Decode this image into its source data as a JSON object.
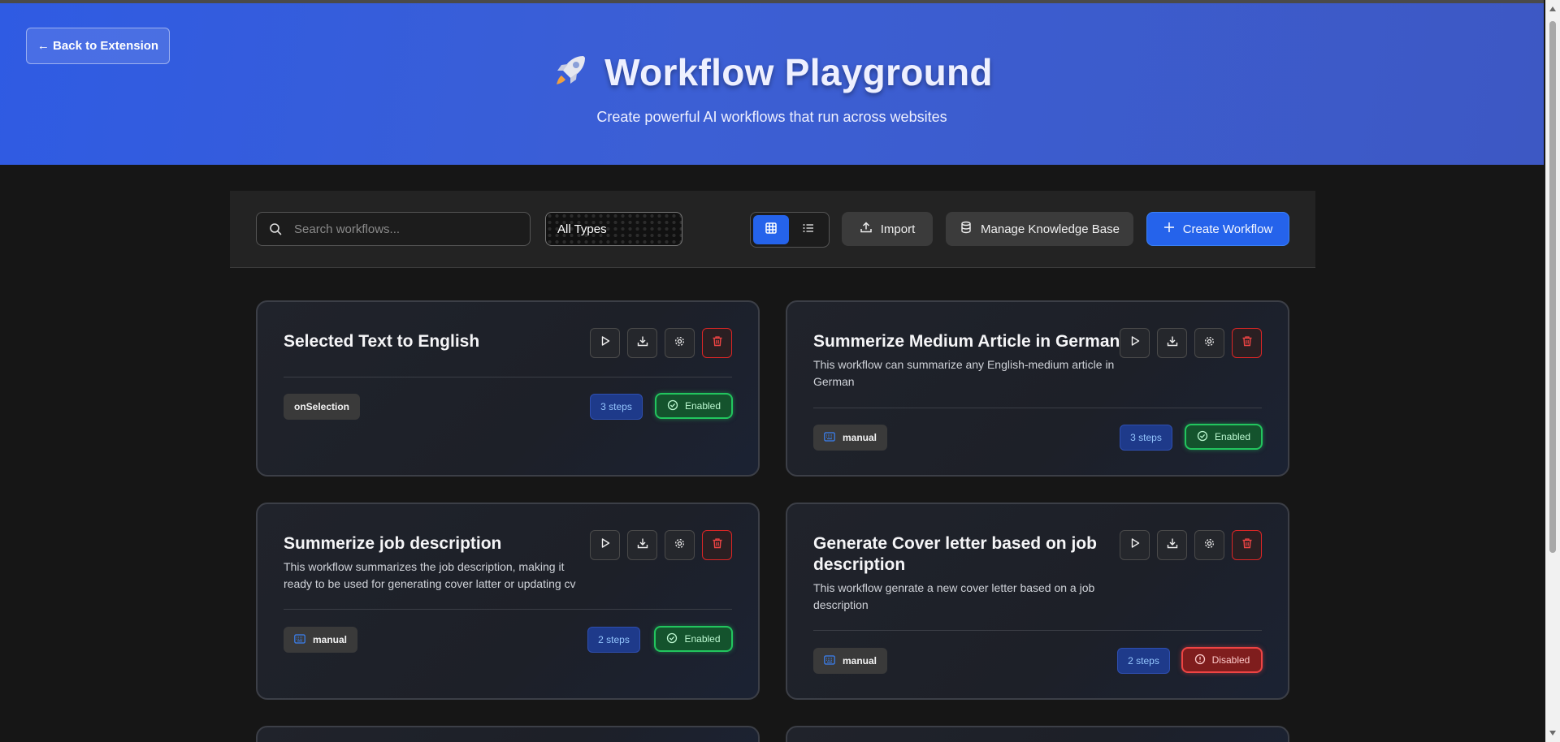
{
  "header": {
    "back_label": "← Back to Extension",
    "title": "Workflow Playground",
    "subtitle": "Create powerful AI workflows that run across websites",
    "gradient_colors": [
      "#2f5be3",
      "#3d58c4"
    ]
  },
  "toolbar": {
    "search_placeholder": "Search workflows...",
    "filter_selected": "All Types",
    "view_modes": [
      "grid",
      "list"
    ],
    "active_view": "grid",
    "import_label": "Import",
    "kb_label": "Manage Knowledge Base",
    "create_label": "Create Workflow"
  },
  "colors": {
    "accent": "#2563eb",
    "enabled": "#22c55e",
    "disabled": "#ef4444",
    "background": "#161616"
  },
  "workflows": [
    {
      "title": "Selected Text to English",
      "description": "",
      "trigger": "onSelection",
      "trigger_icon": "",
      "steps": "3 steps",
      "status": "Enabled",
      "status_icon": "check-circle-icon"
    },
    {
      "title": "Summerize Medium Article in German",
      "description": "This workflow can summarize any English-medium article in German",
      "trigger": "manual",
      "trigger_icon": "keyboard-icon",
      "steps": "3 steps",
      "status": "Enabled",
      "status_icon": "check-circle-icon"
    },
    {
      "title": "Summerize job description",
      "description": "This workflow summarizes the job description, making it ready to be used for generating cover latter or updating cv",
      "trigger": "manual",
      "trigger_icon": "keyboard-icon",
      "steps": "2 steps",
      "status": "Enabled",
      "status_icon": "check-circle-icon"
    },
    {
      "title": "Generate Cover letter based on job description",
      "description": "This workflow genrate a new cover letter based on a job description",
      "trigger": "manual",
      "trigger_icon": "keyboard-icon",
      "steps": "2 steps",
      "status": "Disabled",
      "status_icon": "alert-circle-icon"
    }
  ]
}
